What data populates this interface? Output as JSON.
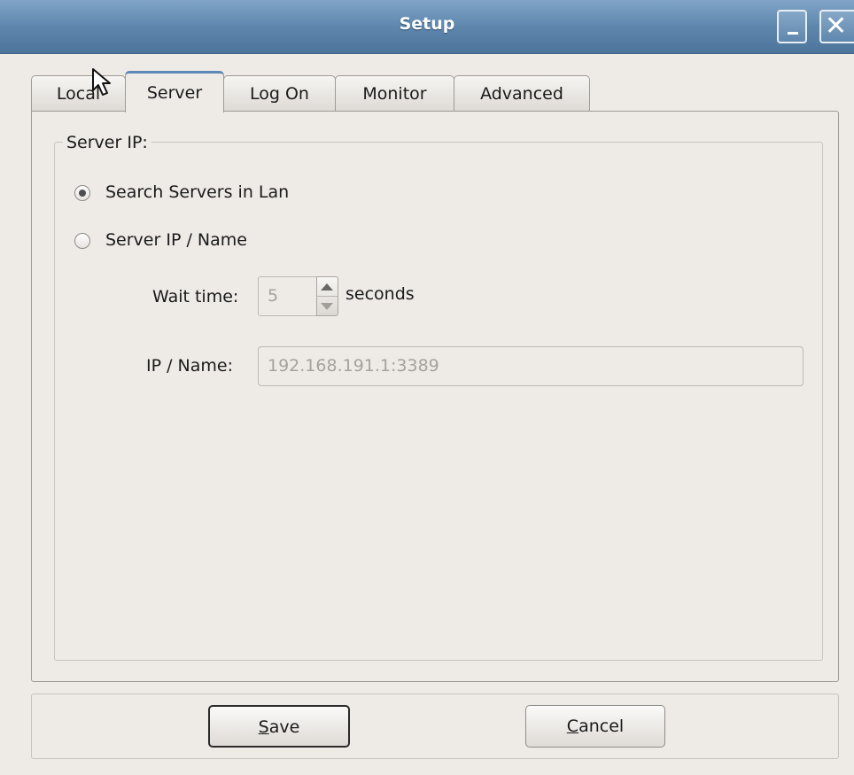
{
  "window": {
    "title": "Setup"
  },
  "tabs": [
    {
      "label": "Local",
      "active": false
    },
    {
      "label": "Server",
      "active": true
    },
    {
      "label": "Log On",
      "active": false
    },
    {
      "label": "Monitor",
      "active": false
    },
    {
      "label": "Advanced",
      "active": false
    }
  ],
  "server_ip": {
    "group_title": "Server IP:",
    "radio_search_label": "Search Servers in Lan",
    "radio_search_checked": true,
    "radio_ip_label": "Server IP / Name",
    "radio_ip_checked": false,
    "wait_time_label": "Wait time:",
    "wait_time_value": "5",
    "wait_time_unit": "seconds",
    "ip_label": "IP / Name:",
    "ip_value": "192.168.191.1:3389"
  },
  "buttons": {
    "save_mnemonic": "S",
    "save_rest": "ave",
    "cancel_mnemonic": "C",
    "cancel_rest": "ancel"
  },
  "icons": {
    "minimize": "minimize-icon",
    "close": "close-icon",
    "cursor": "mouse-pointer-icon"
  }
}
